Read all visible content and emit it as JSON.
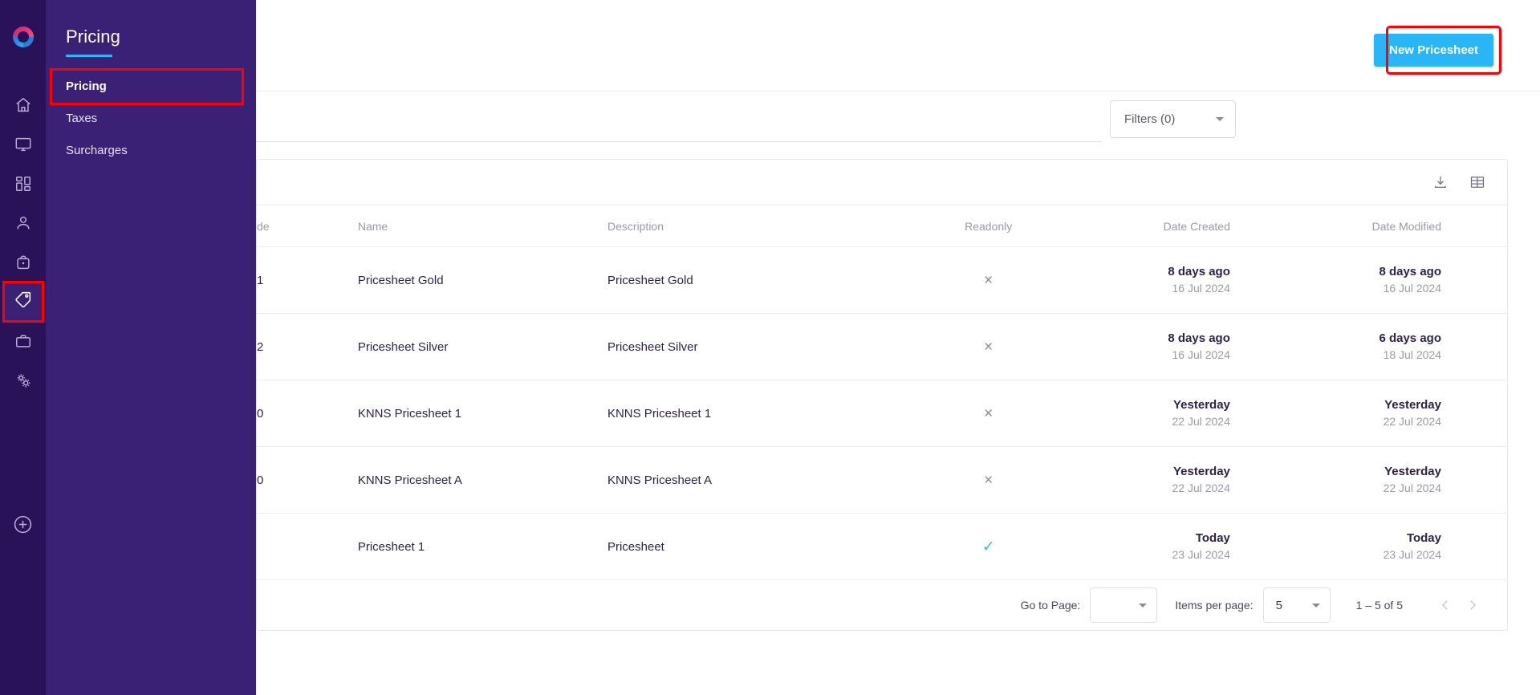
{
  "rail": {
    "logo_name": "brand-logo",
    "items": [
      {
        "name": "home-icon",
        "label": "Home"
      },
      {
        "name": "monitor-icon",
        "label": "Monitor"
      },
      {
        "name": "dashboard-icon",
        "label": "Dashboard"
      },
      {
        "name": "person-icon",
        "label": "Customers"
      },
      {
        "name": "bag-icon",
        "label": "Orders"
      },
      {
        "name": "tag-icon",
        "label": "Pricing"
      },
      {
        "name": "briefcase-icon",
        "label": "Business"
      },
      {
        "name": "gears-icon",
        "label": "Settings"
      }
    ],
    "add_label": "Add"
  },
  "drawer": {
    "title": "Pricing",
    "items": [
      {
        "label": "Pricing"
      },
      {
        "label": "Taxes"
      },
      {
        "label": "Surcharges"
      }
    ]
  },
  "topbar": {
    "new_button": "New Pricesheet"
  },
  "filterbar": {
    "search_value": "",
    "search_placeholder": "",
    "filters_label": "Filters (0)"
  },
  "card": {
    "download_icon": "download-icon",
    "grid_icon": "grid-icon"
  },
  "table": {
    "columns": [
      {
        "key": "code",
        "label": "de"
      },
      {
        "key": "name",
        "label": "Name"
      },
      {
        "key": "description",
        "label": "Description"
      },
      {
        "key": "readonly",
        "label": "Readonly"
      },
      {
        "key": "date_created",
        "label": "Date Created"
      },
      {
        "key": "date_modified",
        "label": "Date Modified"
      }
    ],
    "rows": [
      {
        "code": "1",
        "name": "Pricesheet Gold",
        "description": "Pricesheet Gold",
        "readonly": false,
        "readonly_glyph": "×",
        "created_rel": "8 days ago",
        "created_abs": "16 Jul 2024",
        "modified_rel": "8 days ago",
        "modified_abs": "16 Jul 2024"
      },
      {
        "code": "2",
        "name": "Pricesheet Silver",
        "description": "Pricesheet Silver",
        "readonly": false,
        "readonly_glyph": "×",
        "created_rel": "8 days ago",
        "created_abs": "16 Jul 2024",
        "modified_rel": "6 days ago",
        "modified_abs": "18 Jul 2024"
      },
      {
        "code": "0",
        "name": "KNNS Pricesheet 1",
        "description": "KNNS Pricesheet 1",
        "readonly": false,
        "readonly_glyph": "×",
        "created_rel": "Yesterday",
        "created_abs": "22 Jul 2024",
        "modified_rel": "Yesterday",
        "modified_abs": "22 Jul 2024"
      },
      {
        "code": "0",
        "name": "KNNS Pricesheet A",
        "description": "KNNS Pricesheet A",
        "readonly": false,
        "readonly_glyph": "×",
        "created_rel": "Yesterday",
        "created_abs": "22 Jul 2024",
        "modified_rel": "Yesterday",
        "modified_abs": "22 Jul 2024"
      },
      {
        "code": "",
        "name": "Pricesheet 1",
        "description": "Pricesheet",
        "readonly": true,
        "readonly_glyph": "✓",
        "created_rel": "Today",
        "created_abs": "23 Jul 2024",
        "modified_rel": "Today",
        "modified_abs": "23 Jul 2024"
      }
    ]
  },
  "paginator": {
    "goto_label": "Go to Page:",
    "goto_value": "",
    "items_label": "Items per page:",
    "items_value": "5",
    "range_label": "1 – 5 of 5",
    "prev_name": "previous-page-button",
    "next_name": "next-page-button"
  },
  "colors": {
    "rail_bg": "#2a1259",
    "drawer_bg": "#3a2175",
    "accent": "#29b6f6",
    "highlight_outline": "#ff0000",
    "check_green": "#2ecfa5",
    "text_dark": "#2e2347",
    "text_muted": "#9a9aa8"
  }
}
